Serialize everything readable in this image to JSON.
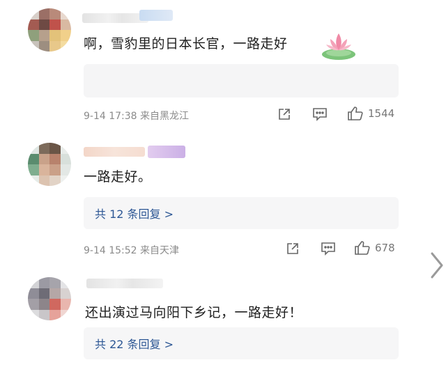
{
  "comments": [
    {
      "text": "啊，雪豹里的日本长官，一路走好",
      "meta": "9-14 17:38 来自黑龙江",
      "like_count": "1544",
      "icons": [
        "share-icon",
        "comment-icon",
        "like-icon"
      ],
      "emoji": "lotus-icon"
    },
    {
      "text": "一路走好。",
      "reply_summary": "共 12 条回复 >",
      "meta": "9-14 15:52 来自天津",
      "like_count": "678",
      "icons": [
        "share-icon",
        "comment-icon",
        "like-icon"
      ]
    },
    {
      "text": "还出演过马向阳下乡记，一路走好！",
      "reply_summary": "共 22 条回复 >"
    }
  ],
  "nav": {
    "next_icon": "chevron-right-icon"
  },
  "colors": {
    "link": "#2c5694",
    "meta": "#8a8a8a",
    "lotus": "#f08aa6",
    "leaf": "#7cc47a"
  }
}
